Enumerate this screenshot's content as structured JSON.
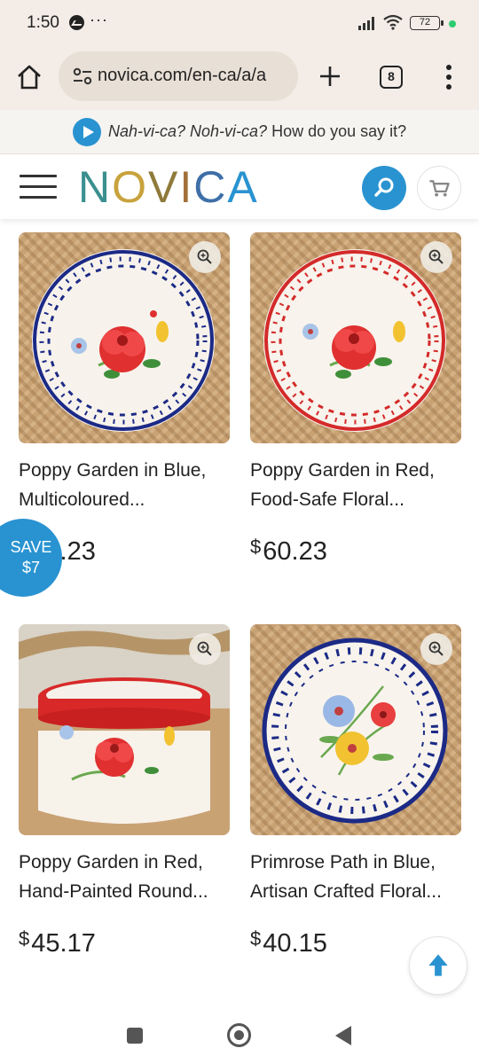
{
  "status_bar": {
    "time": "1:50",
    "dots": "···",
    "battery": "72"
  },
  "browser": {
    "url": "novica.com/en-ca/a/a",
    "tab_count": "8"
  },
  "banner": {
    "pronounce_italic": "Nah-vi-ca? Noh-vi-ca?",
    "pronounce_question": " How do you say it?"
  },
  "header": {
    "logo_text": "NOVICA",
    "logo_colors": [
      "#3a8f8f",
      "#c8a23c",
      "#8f7a3a",
      "#a3703a",
      "#3f6fa8",
      "#2993d1"
    ]
  },
  "products": [
    {
      "title_line1": "Poppy Garden in Blue,",
      "title_line2": "Multicoloured...",
      "currency": "$",
      "price": "60.23",
      "price_visible": ".23",
      "image": "blue-floral-plate"
    },
    {
      "title_line1": "Poppy Garden in Red,",
      "title_line2": "Food-Safe Floral...",
      "currency": "$",
      "price": "60.23",
      "image": "red-floral-plate"
    },
    {
      "title_line1": "Poppy Garden in Red,",
      "title_line2": "Hand-Painted Round...",
      "currency": "$",
      "price": "45.17",
      "image": "red-floral-bowl"
    },
    {
      "title_line1": "Primrose Path in Blue,",
      "title_line2": "Artisan Crafted Floral...",
      "currency": "$",
      "price": "40.15",
      "image": "blue-primrose-plate"
    }
  ],
  "save_badge": {
    "line1": "SAVE",
    "line2": "$7"
  },
  "colors": {
    "accent": "#2993d1",
    "chrome": "#f3ece7"
  }
}
